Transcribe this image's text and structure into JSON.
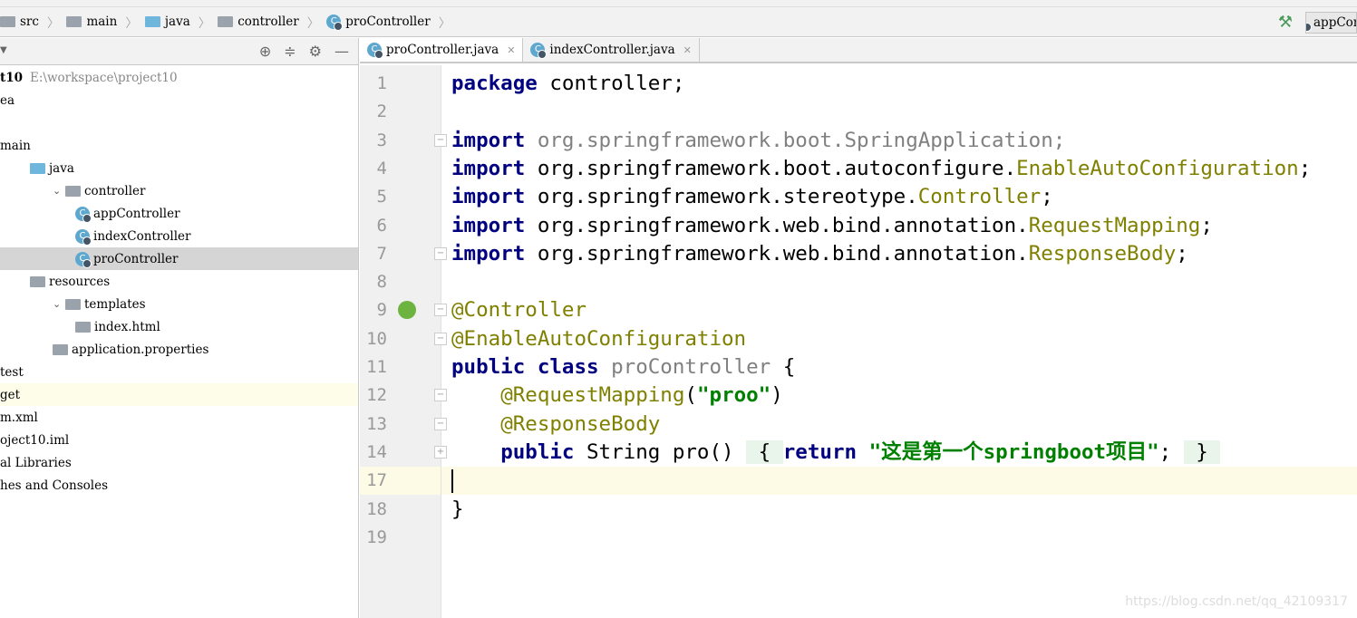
{
  "breadcrumb": [
    "src",
    "main",
    "java",
    "controller",
    "proController"
  ],
  "run_config": "appController",
  "project": {
    "name": "t10",
    "path": "E:\\workspace\\project10"
  },
  "tree": [
    {
      "label": "ea",
      "indent": 0
    },
    {
      "label": "",
      "indent": 0
    },
    {
      "label": "main",
      "indent": 0
    },
    {
      "label": "java",
      "indent": 1
    },
    {
      "label": "controller",
      "indent": 2,
      "chev": "v"
    },
    {
      "label": "appController",
      "indent": 3
    },
    {
      "label": "indexController",
      "indent": 3
    },
    {
      "label": "proController",
      "indent": 3,
      "selected": true
    },
    {
      "label": "resources",
      "indent": 1
    },
    {
      "label": "templates",
      "indent": 2,
      "chev": "v"
    },
    {
      "label": "index.html",
      "indent": 3
    },
    {
      "label": "application.properties",
      "indent": 2
    },
    {
      "label": "test",
      "indent": 0
    },
    {
      "label": "get",
      "indent": 0,
      "highlight": true
    },
    {
      "label": "m.xml",
      "indent": 0
    },
    {
      "label": "oject10.iml",
      "indent": 0
    },
    {
      "label": "al Libraries",
      "indent": 0
    },
    {
      "label": "hes and Consoles",
      "indent": 0
    }
  ],
  "tabs": [
    {
      "label": "proController.java",
      "active": true
    },
    {
      "label": "indexController.java",
      "active": false
    }
  ],
  "code": [
    {
      "n": "1",
      "segs": [
        [
          "package",
          "kw"
        ],
        [
          " controller;",
          ""
        ]
      ]
    },
    {
      "n": "2",
      "segs": []
    },
    {
      "n": "3",
      "segs": [
        [
          "import",
          "kw"
        ],
        [
          " org.springframework.boot.SpringApplication;",
          "gray"
        ]
      ]
    },
    {
      "n": "4",
      "segs": [
        [
          "import",
          "kw"
        ],
        [
          " org.springframework.boot.autoconfigure.",
          ""
        ],
        [
          "EnableAutoConfiguration",
          "ann"
        ],
        [
          ";",
          ""
        ]
      ]
    },
    {
      "n": "5",
      "segs": [
        [
          "import",
          "kw"
        ],
        [
          " org.springframework.stereotype.",
          ""
        ],
        [
          "Controller",
          "ann"
        ],
        [
          ";",
          ""
        ]
      ]
    },
    {
      "n": "6",
      "segs": [
        [
          "import",
          "kw"
        ],
        [
          " org.springframework.web.bind.annotation.",
          ""
        ],
        [
          "RequestMapping",
          "ann"
        ],
        [
          ";",
          ""
        ]
      ]
    },
    {
      "n": "7",
      "segs": [
        [
          "import",
          "kw"
        ],
        [
          " org.springframework.web.bind.annotation.",
          ""
        ],
        [
          "ResponseBody",
          "ann"
        ],
        [
          ";",
          ""
        ]
      ]
    },
    {
      "n": "8",
      "segs": []
    },
    {
      "n": "9",
      "segs": [
        [
          "@Controller",
          "ann"
        ]
      ]
    },
    {
      "n": "10",
      "segs": [
        [
          "@EnableAutoConfiguration",
          "ann"
        ]
      ]
    },
    {
      "n": "11",
      "segs": [
        [
          "public class",
          "kw"
        ],
        [
          " ",
          ""
        ],
        [
          "proController",
          "gray"
        ],
        [
          " {",
          ""
        ]
      ]
    },
    {
      "n": "12",
      "segs": [
        [
          "    ",
          ""
        ],
        [
          "@RequestMapping",
          "ann"
        ],
        [
          "(",
          ""
        ],
        [
          "\"proo\"",
          "str"
        ],
        [
          ")",
          ""
        ]
      ]
    },
    {
      "n": "13",
      "segs": [
        [
          "    ",
          ""
        ],
        [
          "@ResponseBody",
          "ann"
        ]
      ]
    },
    {
      "n": "14",
      "segs": [
        [
          "    ",
          ""
        ],
        [
          "public",
          "kw"
        ],
        [
          " String pro() ",
          ""
        ],
        [
          " { ",
          "fold-str"
        ],
        [
          "return",
          "kw"
        ],
        [
          " ",
          ""
        ],
        [
          "\"这是第一个springboot项目\"",
          "str"
        ],
        [
          "; ",
          ""
        ],
        [
          " } ",
          "fold-str"
        ]
      ]
    },
    {
      "n": "17",
      "segs": [],
      "current": true
    },
    {
      "n": "18",
      "segs": [
        [
          "}",
          ""
        ]
      ]
    },
    {
      "n": "19",
      "segs": []
    }
  ],
  "watermark": "https://blog.csdn.net/qq_42109317"
}
